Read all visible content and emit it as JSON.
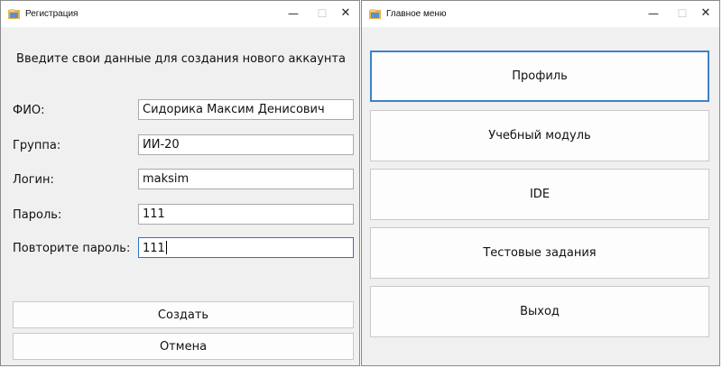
{
  "registration_window": {
    "title": "Регистрация",
    "heading": "Введите свои данные для создания нового аккаунта",
    "fields": [
      {
        "label": "ФИО:",
        "value": "Сидорика Максим Денисович"
      },
      {
        "label": "Группа:",
        "value": "ИИ-20"
      },
      {
        "label": "Логин:",
        "value": "maksim"
      },
      {
        "label": "Пароль:",
        "value": "111"
      },
      {
        "label": "Повторите пароль:",
        "value": "111"
      }
    ],
    "create_label": "Создать",
    "cancel_label": "Отмена"
  },
  "main_window": {
    "title": "Главное меню",
    "menu": [
      "Профиль",
      "Учебный модуль",
      "IDE",
      "Тестовые задания",
      "Выход"
    ]
  },
  "window_controls": {
    "minimize_icon": "minimize-icon",
    "maximize_icon": "maximize-icon",
    "close_icon": "close-icon"
  },
  "colors": {
    "focus_border": "#3d82c8",
    "window_bg": "#f0f0f0"
  }
}
